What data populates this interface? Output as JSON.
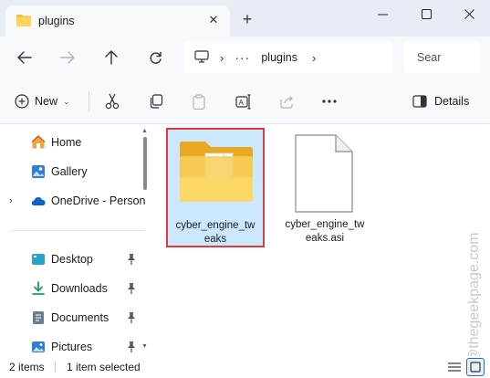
{
  "window": {
    "tab_title": "plugins",
    "close_tab": "✕",
    "new_tab": "+"
  },
  "address": {
    "breadcrumb_dots": "···",
    "current": "plugins"
  },
  "search": {
    "placeholder": "Sear"
  },
  "toolbar": {
    "new_label": "New",
    "details_label": "Details"
  },
  "sidebar": {
    "items": [
      {
        "label": "Home",
        "icon": "home-icon"
      },
      {
        "label": "Gallery",
        "icon": "gallery-icon"
      },
      {
        "label": "OneDrive - Person",
        "icon": "onedrive-icon"
      },
      {
        "label": "Desktop",
        "icon": "desktop-icon"
      },
      {
        "label": "Downloads",
        "icon": "downloads-icon"
      },
      {
        "label": "Documents",
        "icon": "documents-icon"
      },
      {
        "label": "Pictures",
        "icon": "pictures-icon"
      }
    ]
  },
  "files": [
    {
      "name": "cyber_engine_tweaks",
      "type": "folder",
      "line1": "cyber_engine_tw",
      "line2": "eaks",
      "selected": true
    },
    {
      "name": "cyber_engine_tweaks.asi",
      "type": "file",
      "line1": "cyber_engine_tw",
      "line2": "eaks.asi",
      "selected": false
    }
  ],
  "status": {
    "item_count": "2 items",
    "selection": "1 item selected"
  },
  "watermark": "@thegeekpage.com",
  "colors": {
    "accent": "#0067c0",
    "selection_bg": "#cce8ff",
    "highlight_border": "#e0393e",
    "folder_yellow": "#f7c948"
  }
}
